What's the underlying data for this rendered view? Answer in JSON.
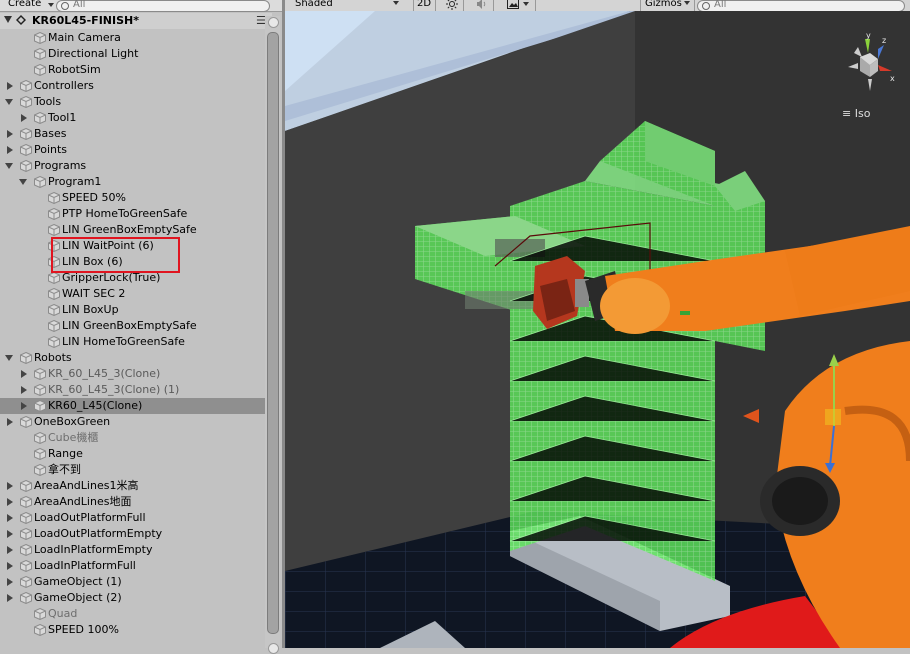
{
  "hierarchy": {
    "create_label": "Create",
    "search_placeholder": "All",
    "scene_title": "KR60L45-FINISH*",
    "scene_menu": "☰",
    "rows": [
      {
        "label": "Main Camera"
      },
      {
        "label": "Directional Light"
      },
      {
        "label": "RobotSim"
      },
      {
        "label": "Controllers"
      },
      {
        "label": "Tools"
      },
      {
        "label": "Tool1"
      },
      {
        "label": "Bases"
      },
      {
        "label": "Points"
      },
      {
        "label": "Programs"
      },
      {
        "label": "Program1"
      },
      {
        "label": "SPEED 50%"
      },
      {
        "label": "PTP HomeToGreenSafe"
      },
      {
        "label": "LIN GreenBoxEmptySafe"
      },
      {
        "label": "LIN WaitPoint (6)"
      },
      {
        "label": "LIN Box (6)"
      },
      {
        "label": "GripperLock(True)"
      },
      {
        "label": "WAIT SEC 2"
      },
      {
        "label": "LIN BoxUp"
      },
      {
        "label": "LIN GreenBoxEmptySafe"
      },
      {
        "label": "LIN HomeToGreenSafe"
      },
      {
        "label": "Robots"
      },
      {
        "label": "KR_60_L45_3(Clone)"
      },
      {
        "label": "KR_60_L45_3(Clone) (1)"
      },
      {
        "label": "KR60_L45(Clone)"
      },
      {
        "label": "OneBoxGreen"
      },
      {
        "label": "Cube機櫃"
      },
      {
        "label": "Range"
      },
      {
        "label": "拿不到"
      },
      {
        "label": "AreaAndLines1米高"
      },
      {
        "label": "AreaAndLines地面"
      },
      {
        "label": "LoadOutPlatformFull"
      },
      {
        "label": "LoadOutPlatformEmpty"
      },
      {
        "label": "LoadInPlatformEmpty"
      },
      {
        "label": "LoadInPlatformFull"
      },
      {
        "label": "GameObject (1)"
      },
      {
        "label": "GameObject (2)"
      },
      {
        "label": "Quad"
      },
      {
        "label": "SPEED 100%"
      }
    ]
  },
  "scene_view": {
    "shading_mode": "Shaded",
    "mode_2d": "2D",
    "gizmos_label": "Gizmos",
    "search_placeholder": "All",
    "projection_label": "Iso",
    "gizmo_axes": {
      "y": "y",
      "z": "z",
      "x": "x"
    }
  },
  "colors": {
    "highlight_box": "#e0141f",
    "robot_orange": "#f07e1c",
    "stack_green": "#5cf05c",
    "background_wall": "#3c3c3c"
  }
}
